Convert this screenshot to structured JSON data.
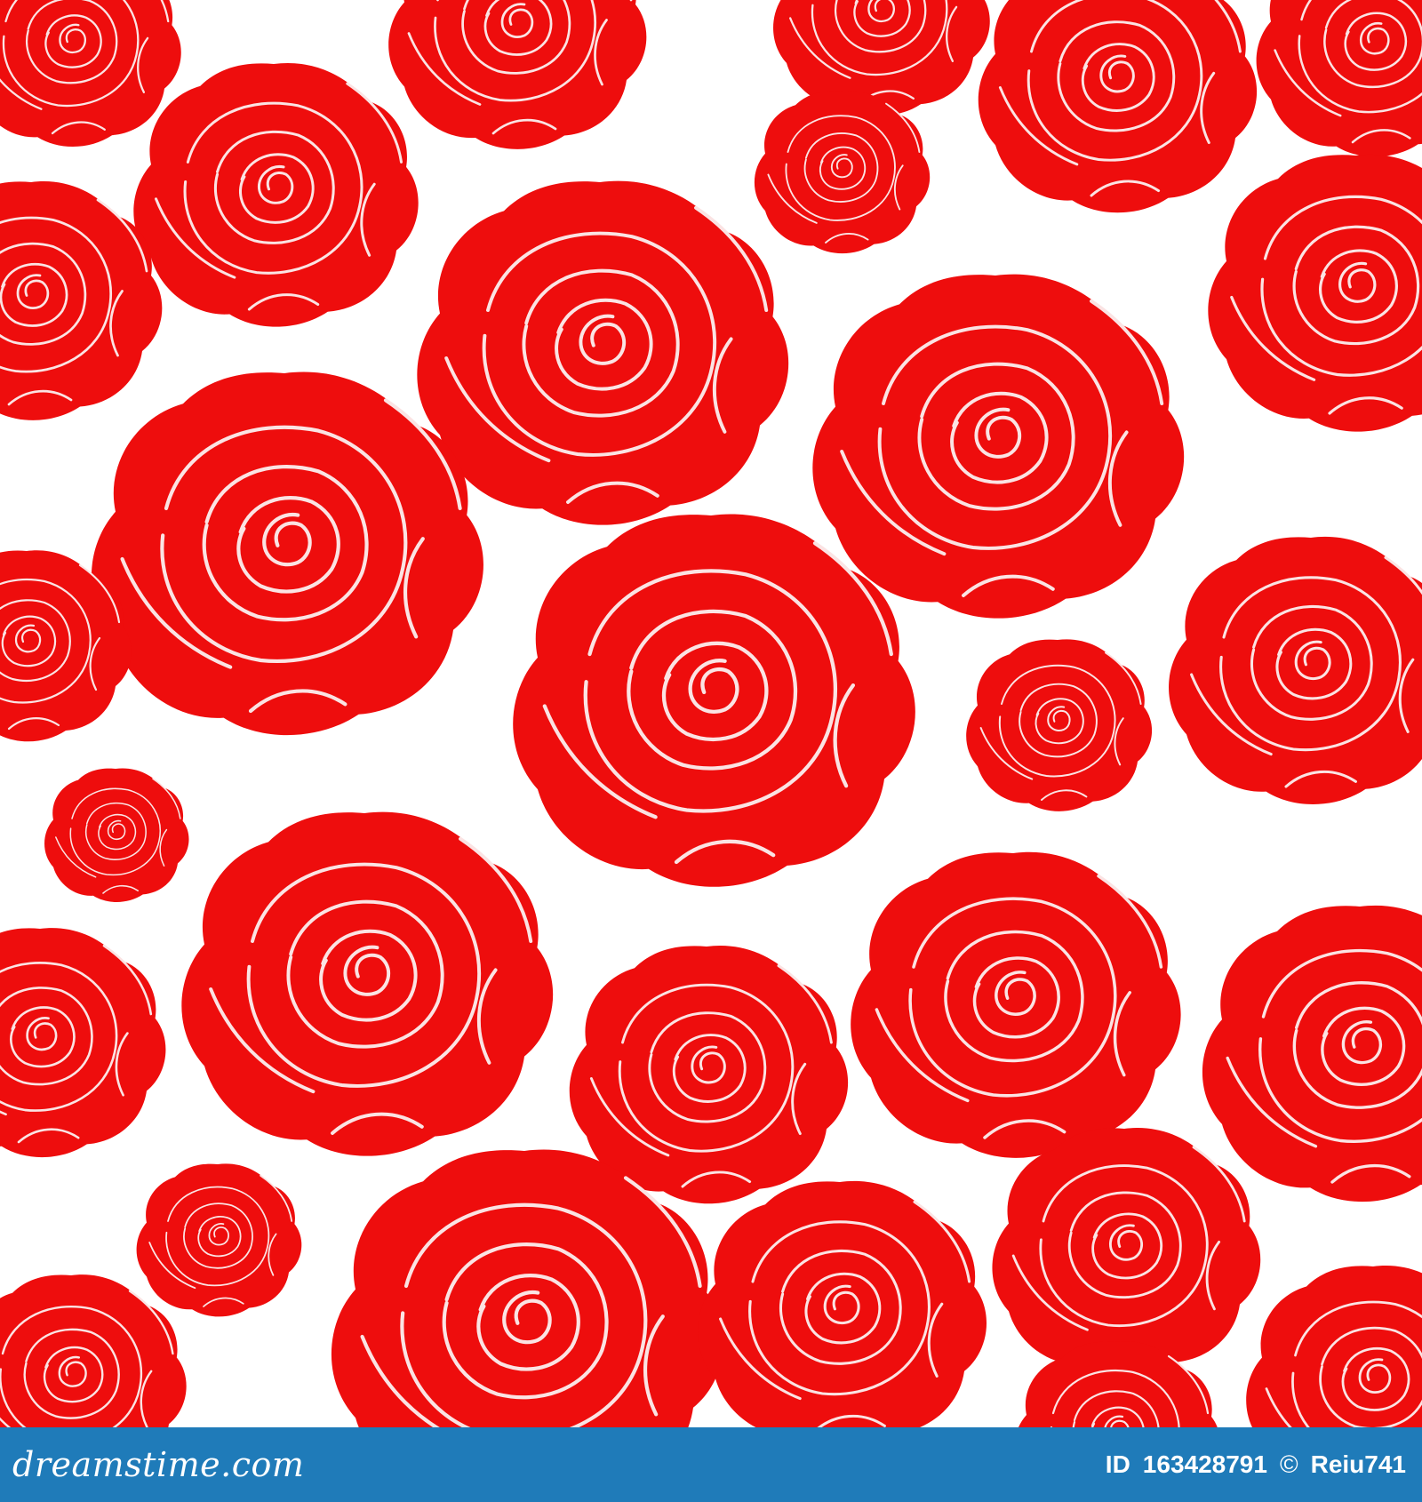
{
  "footer": {
    "brand": "dreamstime.com",
    "id_label": "ID",
    "id_value": "163428791",
    "copyright_symbol": "©",
    "author": "Reiu741"
  },
  "colors": {
    "rose": "#ee0d0d",
    "background": "#ffffff",
    "footer": "#1f7bb9",
    "vein": "#fbe3e3"
  }
}
